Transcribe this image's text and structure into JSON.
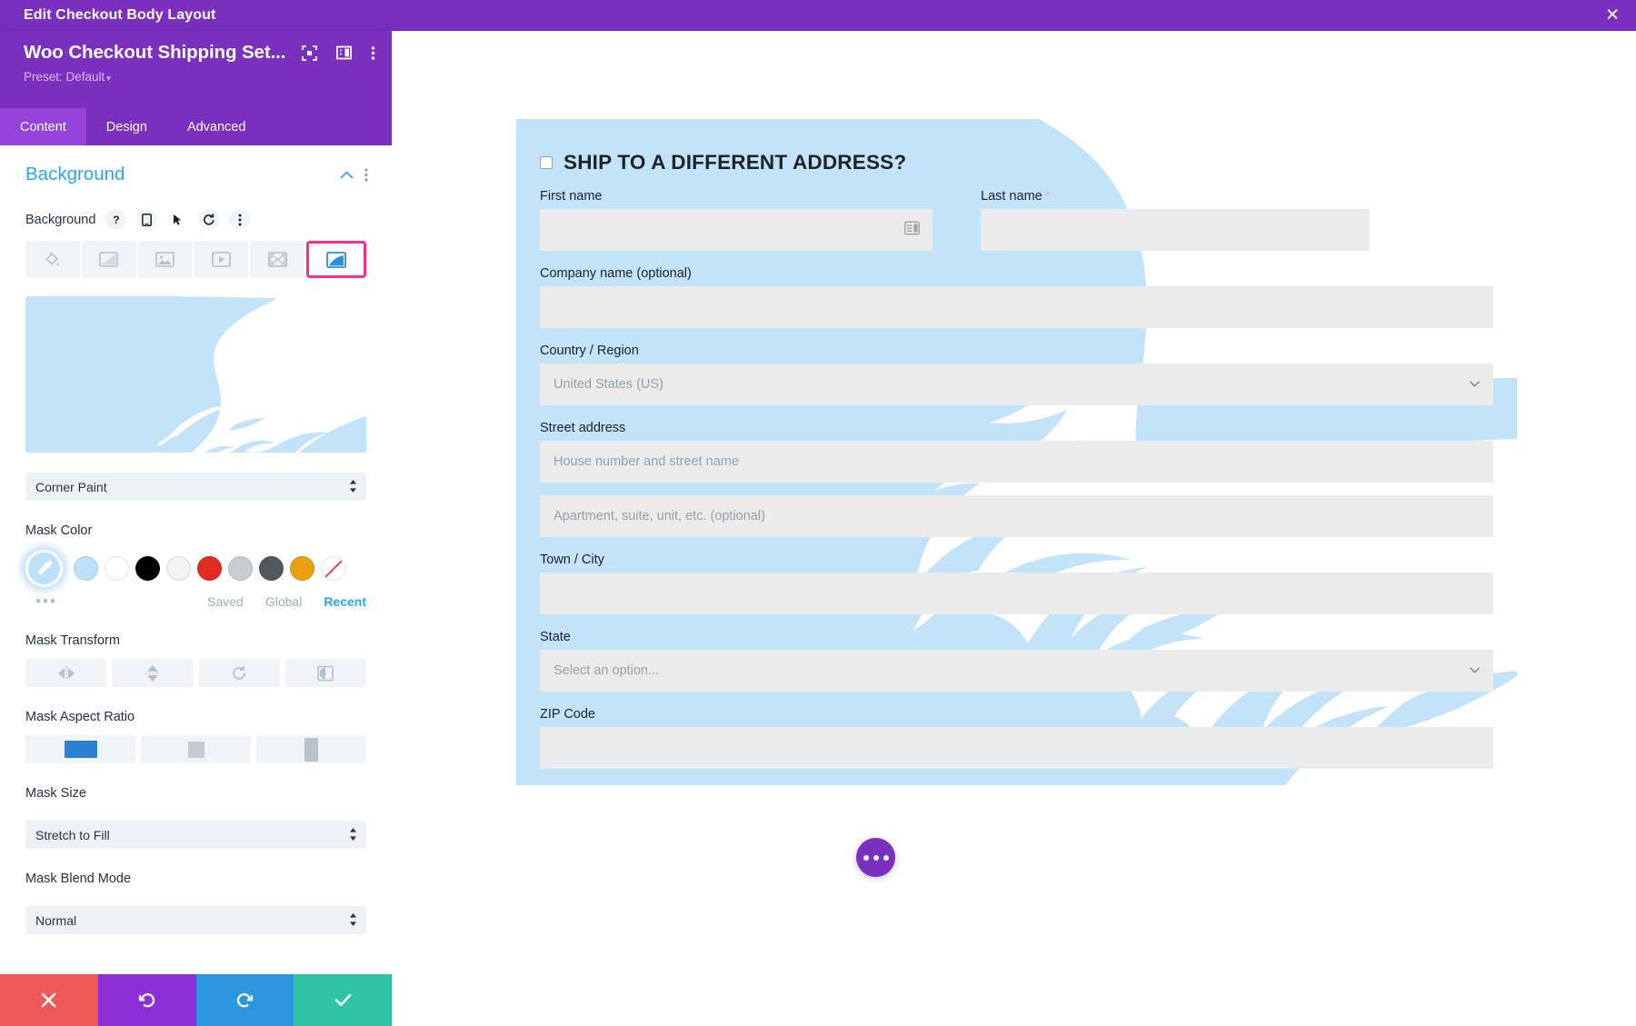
{
  "titlebar": {
    "title": "Edit Checkout Body Layout",
    "close_icon": "close-icon",
    "close_label": "✕"
  },
  "panel": {
    "module_name": "Woo Checkout Shipping Set...",
    "preset_label": "Preset: Default",
    "preset_caret": "▾",
    "header_icons": [
      "fullscreen-icon",
      "layout-toggle-icon",
      "kebab-menu-icon"
    ],
    "tabs": [
      {
        "label": "Content",
        "active": true
      },
      {
        "label": "Design",
        "active": false
      },
      {
        "label": "Advanced",
        "active": false
      }
    ],
    "section": {
      "title": "Background",
      "collapse_icon": "chevron-up-icon",
      "options_icon": "kebab-menu-icon"
    },
    "background_field": {
      "label": "Background",
      "controls": [
        "help-icon",
        "responsive-icon",
        "hover-icon",
        "reset-icon",
        "kebab-menu-icon"
      ],
      "help_glyph": "?",
      "types": [
        {
          "name": "background-color",
          "selected": false
        },
        {
          "name": "background-gradient",
          "selected": false
        },
        {
          "name": "background-image",
          "selected": false
        },
        {
          "name": "background-video",
          "selected": false
        },
        {
          "name": "background-pattern",
          "selected": false
        },
        {
          "name": "background-mask",
          "selected": true
        }
      ]
    },
    "mask_style": {
      "label": "",
      "value": "Corner Paint"
    },
    "mask_color": {
      "label": "Mask Color",
      "picker_icon": "eyedropper-icon",
      "more_dots": "•••",
      "swatches": [
        {
          "name": "swatch-light-blue",
          "hex": "#bfe0fa"
        },
        {
          "name": "swatch-white",
          "hex": "#ffffff"
        },
        {
          "name": "swatch-black",
          "hex": "#000000"
        },
        {
          "name": "swatch-offwhite",
          "hex": "#f4f4f4"
        },
        {
          "name": "swatch-red",
          "hex": "#e02b20"
        },
        {
          "name": "swatch-light-gray",
          "hex": "#c9ccd0"
        },
        {
          "name": "swatch-dark-gray",
          "hex": "#53585e"
        },
        {
          "name": "swatch-amber",
          "hex": "#e8a00c"
        },
        {
          "name": "swatch-none",
          "hex": "#ffffff"
        }
      ],
      "links": [
        {
          "label": "Saved",
          "active": false
        },
        {
          "label": "Global",
          "active": false
        },
        {
          "label": "Recent",
          "active": true
        }
      ]
    },
    "mask_transform": {
      "label": "Mask Transform",
      "buttons": [
        {
          "name": "flip-horizontal-icon"
        },
        {
          "name": "flip-vertical-icon"
        },
        {
          "name": "rotate-icon"
        },
        {
          "name": "invert-icon"
        }
      ]
    },
    "mask_aspect_ratio": {
      "label": "Mask Aspect Ratio",
      "options": [
        {
          "name": "aspect-landscape",
          "selected": true
        },
        {
          "name": "aspect-square",
          "selected": false
        },
        {
          "name": "aspect-portrait",
          "selected": false
        }
      ]
    },
    "mask_size": {
      "label": "Mask Size",
      "value": "Stretch to Fill"
    },
    "mask_blend_mode": {
      "label": "Mask Blend Mode",
      "value": "Normal"
    },
    "footer": [
      {
        "name": "cancel-button",
        "glyph": "✕"
      },
      {
        "name": "undo-button",
        "glyph": "↺"
      },
      {
        "name": "redo-button",
        "glyph": "↻"
      },
      {
        "name": "save-button",
        "glyph": "✔"
      }
    ]
  },
  "checkout": {
    "heading": "SHIP TO A DIFFERENT ADDRESS?",
    "checkbox_checked": false,
    "fields": {
      "first_name": {
        "label": "First name",
        "value": "",
        "placeholder": ""
      },
      "last_name": {
        "label": "Last name",
        "required_mark": "*",
        "value": "",
        "placeholder": ""
      },
      "company_name": {
        "label": "Company name (optional)",
        "value": "",
        "placeholder": ""
      },
      "country_region": {
        "label": "Country / Region",
        "value": "United States (US)"
      },
      "street_address": {
        "label": "Street address",
        "placeholder": "House number and street name",
        "value": ""
      },
      "address_line2": {
        "label": "",
        "placeholder": "Apartment, suite, unit, etc. (optional)",
        "value": ""
      },
      "town_city": {
        "label": "Town / City",
        "value": "",
        "placeholder": ""
      },
      "state": {
        "label": "State",
        "value": "Select an option..."
      },
      "zip_code": {
        "label": "ZIP Code",
        "value": "",
        "placeholder": ""
      }
    }
  },
  "fab": {
    "name": "page-settings-button",
    "glyph": "•••"
  },
  "colors": {
    "brand_purple": "#7a2fbf",
    "tab_active": "#9442d8",
    "accent_blue": "#2ea3f2",
    "highlight_pink": "#ff2d87",
    "mask_blue": "#c3e3fb",
    "input_gray": "#ebebeb"
  }
}
